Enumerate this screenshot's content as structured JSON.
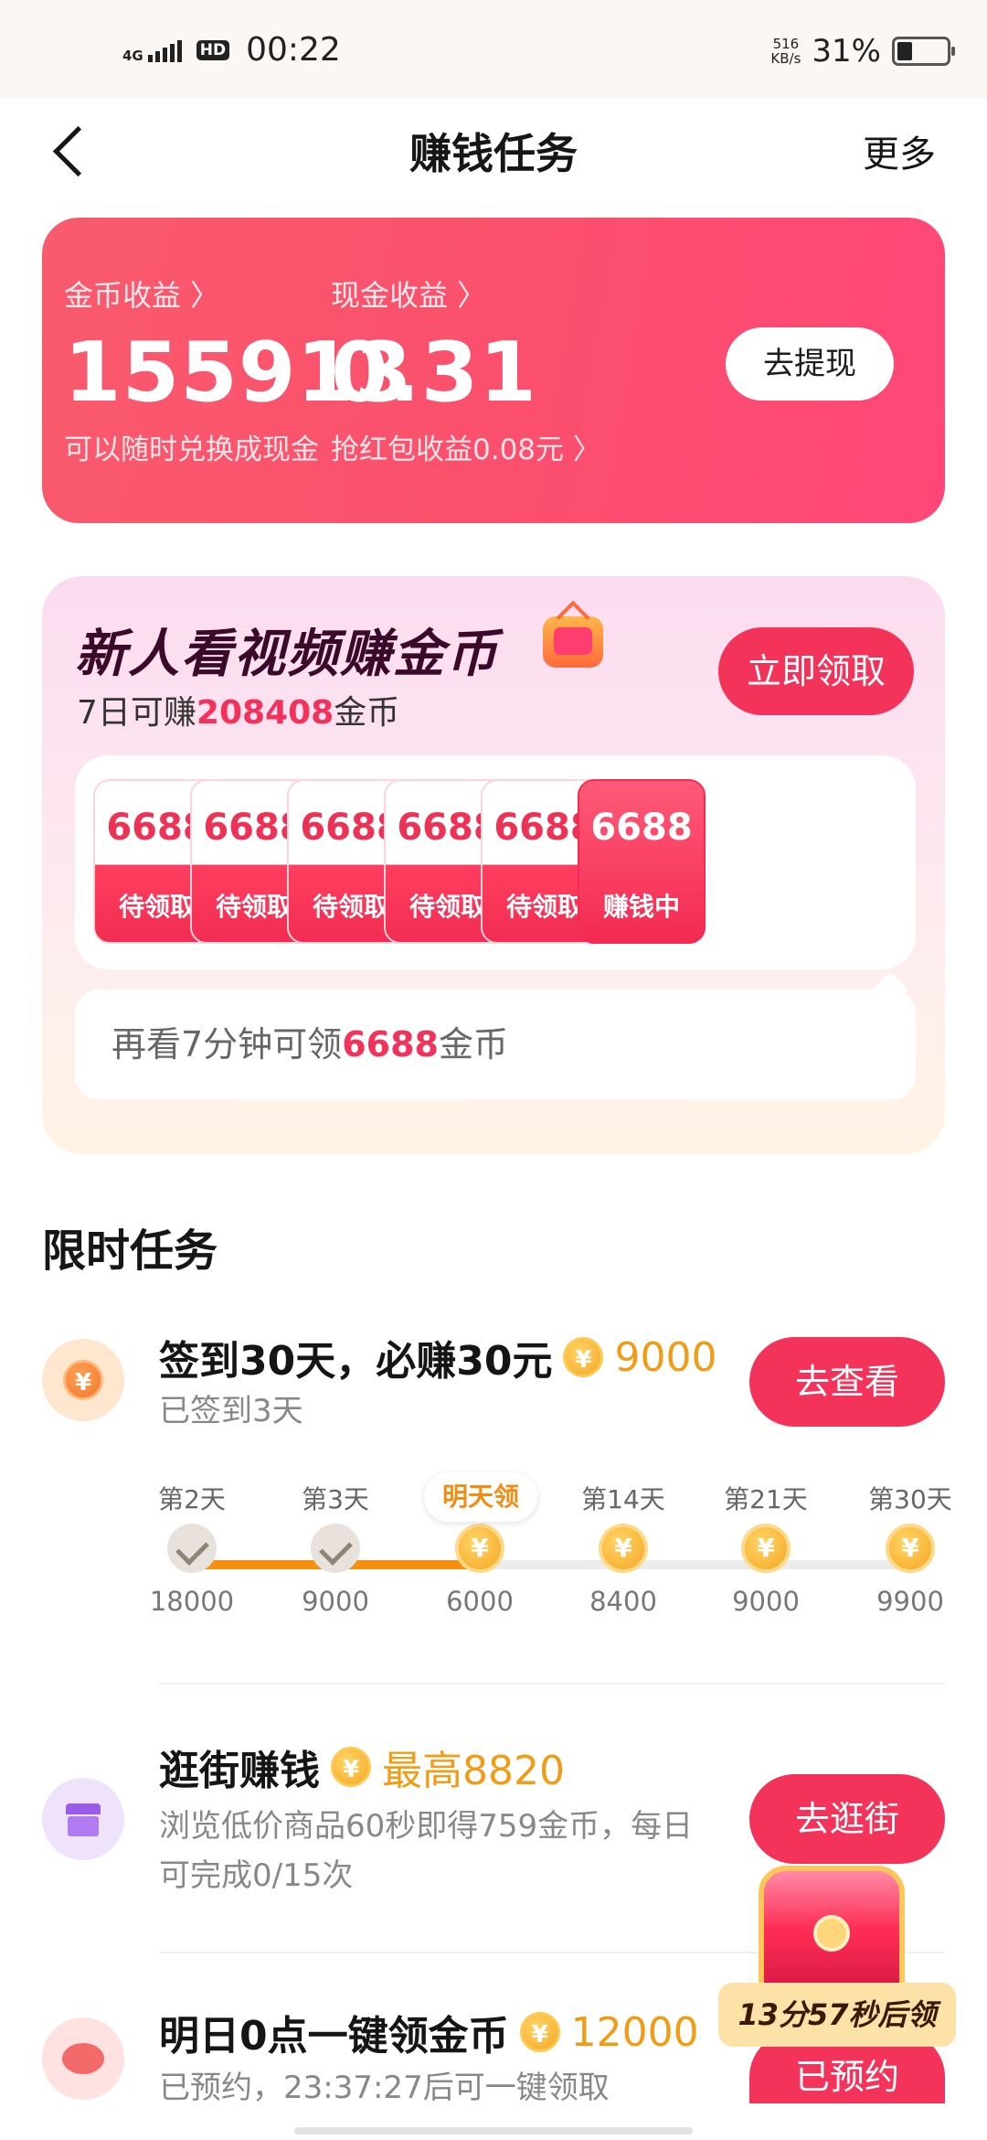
{
  "status_bar": {
    "network": "4G",
    "hd": "HD",
    "time": "00:22",
    "speed_value": "516",
    "speed_unit": "KB/s",
    "battery_percent": "31%",
    "battery_level": 0.31
  },
  "nav": {
    "title": "赚钱任务",
    "more": "更多"
  },
  "earnings": {
    "coin_label": "金币收益 〉",
    "coin_value": "155913",
    "coin_sub": "可以随时兑换成现金",
    "cash_label": "现金收益 〉",
    "cash_value": "0.31",
    "cash_sub": "抢红包收益0.08元 〉",
    "withdraw_button": "去提现"
  },
  "newbie": {
    "title": "新人看视频赚金币",
    "sub_prefix": "7日可赚",
    "sub_amount": "208408",
    "sub_suffix": "金币",
    "claim_button": "立即领取",
    "days": [
      {
        "value": "6688",
        "status": "待领取"
      },
      {
        "value": "6688",
        "status": "待领取"
      },
      {
        "value": "6688",
        "status": "待领取"
      },
      {
        "value": "6688",
        "status": "待领取"
      },
      {
        "value": "6688",
        "status": "待领取"
      },
      {
        "value": "6688",
        "status": "赚钱中"
      }
    ],
    "tip_prefix": "再看7分钟可领",
    "tip_amount": "6688",
    "tip_suffix": "金币"
  },
  "limited": {
    "section_title": "限时任务",
    "checkin": {
      "title": "签到30天，必赚30元",
      "amount": "9000",
      "sub": "已签到3天",
      "button": "去查看",
      "badge": "明天领",
      "timeline": [
        {
          "day": "第2天",
          "value": "18000",
          "done": true
        },
        {
          "day": "第3天",
          "value": "9000",
          "done": true
        },
        {
          "day": "",
          "value": "6000",
          "done": false
        },
        {
          "day": "第14天",
          "value": "8400",
          "done": false
        },
        {
          "day": "第21天",
          "value": "9000",
          "done": false
        },
        {
          "day": "第30天",
          "value": "9900",
          "done": false
        }
      ]
    },
    "shopping": {
      "title": "逛街赚钱",
      "amount": "最高8820",
      "sub": "浏览低价商品60秒即得759金币，每日可完成0/15次",
      "button": "去逛街"
    },
    "tomorrow": {
      "title": "明日0点一键领金币",
      "amount": "12000",
      "sub": "已预约，23:37:27后可一键领取",
      "button": "已预约"
    },
    "chest_label": "13分57秒后领"
  },
  "coin_glyph": "¥",
  "colors": {
    "primary": "#f3335a",
    "coin": "#f5a623",
    "amount": "#f29b15"
  }
}
